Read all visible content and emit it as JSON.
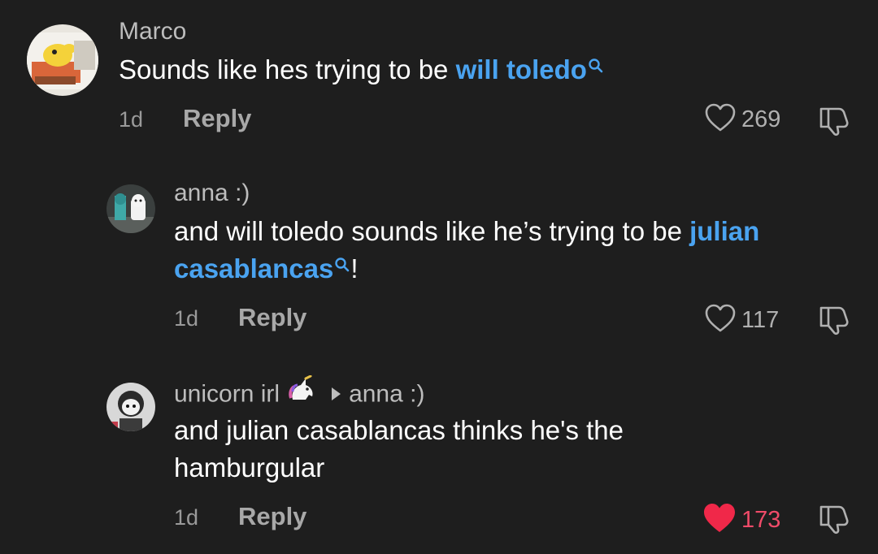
{
  "comments": [
    {
      "username": "Marco",
      "text_before": "Sounds like hes trying to be ",
      "link": "will toledo",
      "text_after": "",
      "time": "1d",
      "reply_label": "Reply",
      "likes": "269",
      "liked": false
    },
    {
      "username": "anna :)",
      "text_before": "and will toledo sounds like he’s trying to be ",
      "link": "julian casablancas",
      "text_after": "!",
      "time": "1d",
      "reply_label": "Reply",
      "likes": "117",
      "liked": false
    },
    {
      "username": "unicorn irl",
      "username_emoji": "unicorn-emoji",
      "reply_to": "anna :)",
      "text": "and julian casablancas thinks he's the hamburgular",
      "time": "1d",
      "reply_label": "Reply",
      "likes": "173",
      "liked": true
    }
  ],
  "colors": {
    "background": "#1e1e1e",
    "link": "#4aa3f0",
    "liked_heart": "#f02849"
  }
}
